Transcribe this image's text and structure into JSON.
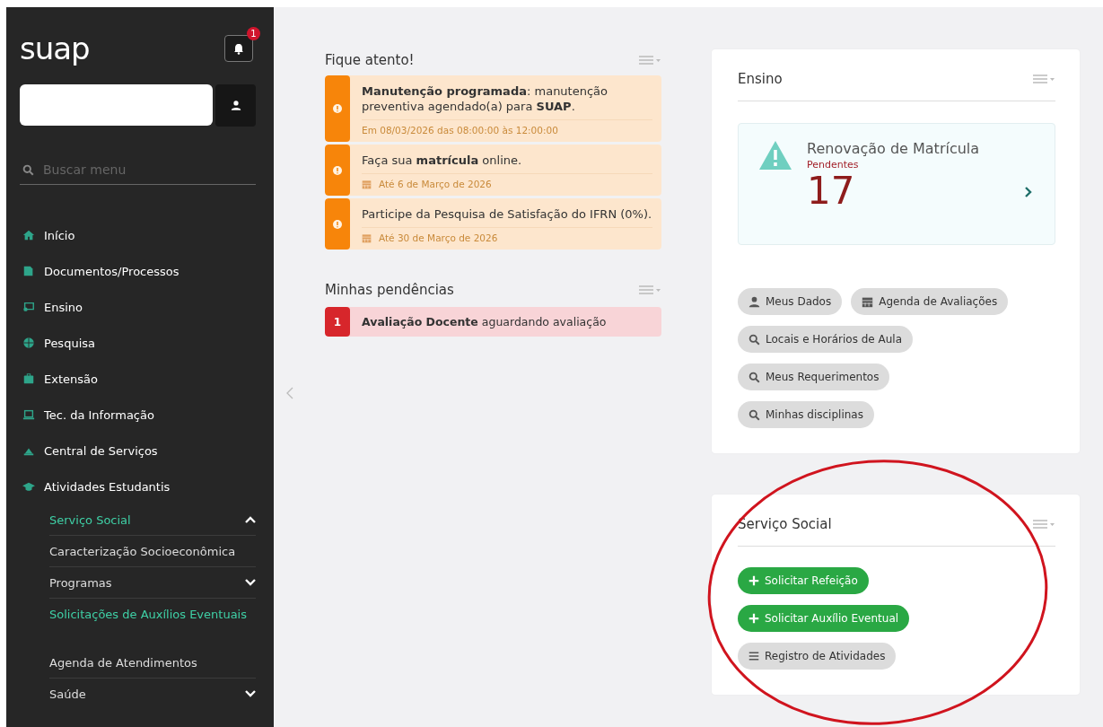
{
  "sidebar": {
    "logo": "suap",
    "notification_count": "1",
    "search": {
      "placeholder": "Buscar menu"
    },
    "items": [
      {
        "label": "Início",
        "selected": false
      },
      {
        "label": "Documentos/Processos",
        "selected": false
      },
      {
        "label": "Ensino",
        "selected": false
      },
      {
        "label": "Pesquisa",
        "selected": false
      },
      {
        "label": "Extensão",
        "selected": false
      },
      {
        "label": "Tec. da Informação",
        "selected": false
      },
      {
        "label": "Central de Serviços",
        "selected": false
      },
      {
        "label": "Atividades Estudantis",
        "selected": false,
        "children": [
          {
            "label": "Serviço Social",
            "selected": true,
            "expanded": true,
            "children": [
              {
                "label": "Caracterização Socioeconômica",
                "selected": false
              },
              {
                "label": "Programas",
                "selected": false,
                "expanded": false
              },
              {
                "label": "Solicitações de Auxílios Eventuais",
                "selected": true
              }
            ]
          },
          {
            "label": "Agenda de Atendimentos",
            "selected": false
          },
          {
            "label": "Saúde",
            "selected": false,
            "expanded": false
          }
        ]
      }
    ]
  },
  "alerts": {
    "title": "Fique atento!",
    "items": [
      {
        "kind": "scheduled",
        "text": "**Manutenção programada**: manutenção preventiva agendado(a) para **SUAP**.",
        "footer": "Em 08/03/2026 das 08:00:00 às 12:00:00"
      },
      {
        "kind": "deadline",
        "text": "Faça sua **matrícula** online.",
        "footer": "Até 6 de Março de 2026"
      },
      {
        "kind": "deadline",
        "text": "Participe da Pesquisa de Satisfação do IFRN (0%).",
        "footer": "Até 30 de Março de 2026"
      }
    ]
  },
  "pending": {
    "title": "Minhas pendências",
    "items": [
      {
        "count": "1",
        "text": "**Avaliação Docente** aguardando avaliação"
      }
    ]
  },
  "ensino": {
    "title": "Ensino",
    "highlight": {
      "title": "Renovação de Matrícula",
      "subtitle": "Pendentes",
      "count": "17"
    },
    "buttons": [
      {
        "kind": "user",
        "label": "Meus Dados"
      },
      {
        "kind": "calendar",
        "label": "Agenda de Avaliações"
      },
      {
        "kind": "search",
        "label": "Locais e Horários de Aula"
      },
      {
        "kind": "search",
        "label": "Meus Requerimentos"
      },
      {
        "kind": "search",
        "label": "Minhas disciplinas"
      }
    ]
  },
  "social": {
    "title": "Serviço Social",
    "buttons": [
      {
        "kind": "add",
        "label": "Solicitar Refeição"
      },
      {
        "kind": "add",
        "label": "Solicitar Auxílio Eventual"
      },
      {
        "kind": "list",
        "label": "Registro de Atividades"
      }
    ]
  }
}
